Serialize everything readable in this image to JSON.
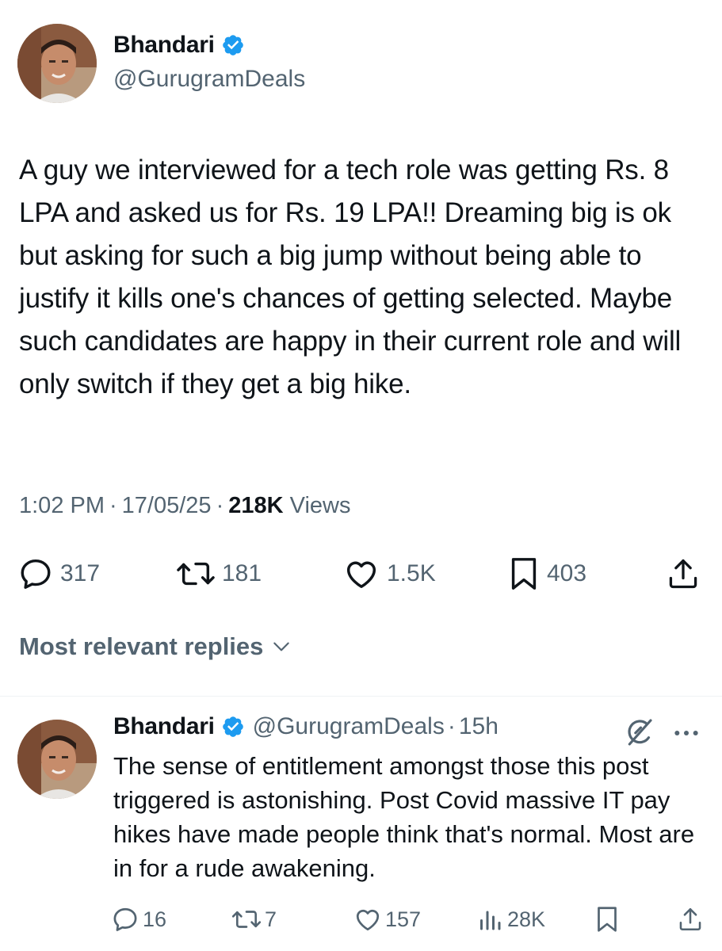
{
  "tweet": {
    "author": {
      "name": "Bhandari",
      "handle": "@GurugramDeals",
      "verified": true
    },
    "text": "A guy we interviewed for a tech role was getting Rs. 8 LPA and asked us for Rs. 19 LPA!! Dreaming big is ok but asking for such a big jump without being able to justify it kills one's chances of getting selected. Maybe such candidates are happy in their current role and will only switch if they get a big hike.",
    "time": "1:02 PM",
    "date": "17/05/25",
    "views_count": "218K",
    "views_label": "Views",
    "separator": "·",
    "stats": {
      "replies": "317",
      "reposts": "181",
      "likes": "1.5K",
      "bookmarks": "403"
    }
  },
  "sort": {
    "label": "Most relevant replies"
  },
  "reply": {
    "author": {
      "name": "Bhandari",
      "handle": "@GurugramDeals",
      "verified": true
    },
    "time": "15h",
    "separator": "·",
    "text": "The sense of entitlement amongst those this post triggered is astonishing. Post Covid massive IT pay hikes have made people think that's normal. Most are in for a rude awakening.",
    "stats": {
      "replies": "16",
      "reposts": "7",
      "likes": "157",
      "views": "28K"
    }
  },
  "colors": {
    "verified": "#1d9bf0",
    "text_primary": "#0f1419",
    "text_secondary": "#536471"
  },
  "icons": [
    "verified-badge-icon",
    "reply-icon",
    "repost-icon",
    "like-icon",
    "bookmark-icon",
    "share-icon",
    "chevron-down-icon",
    "grok-icon",
    "more-icon",
    "views-icon"
  ]
}
